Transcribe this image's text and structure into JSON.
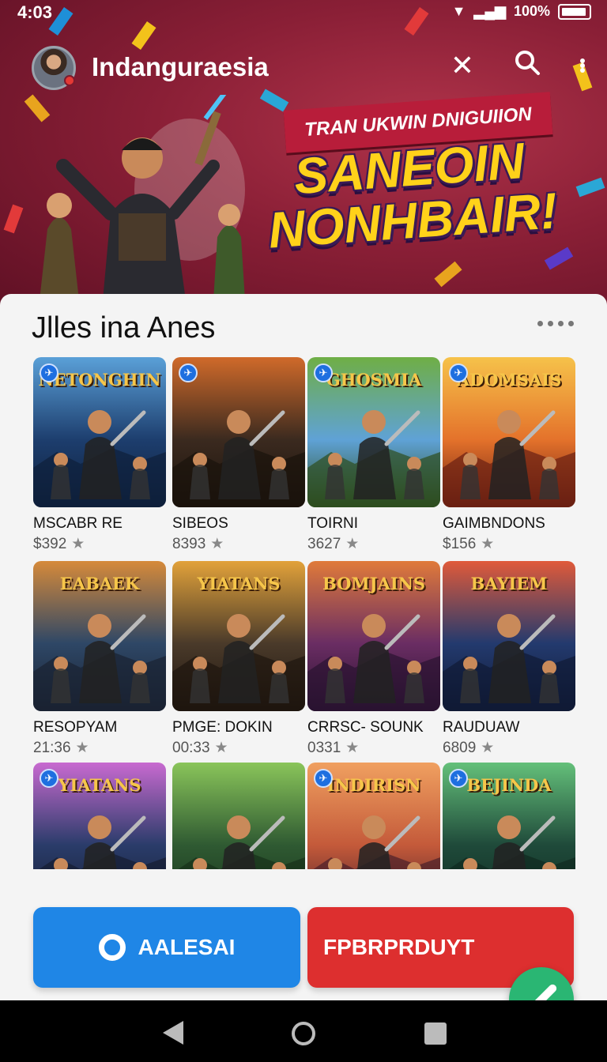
{
  "status": {
    "time": "4:03",
    "battery": "100%"
  },
  "appbar": {
    "title": "Indanguraesia"
  },
  "banner": {
    "ribbon": "TRAN UKWIN DNIGUIION",
    "line1": "SANEOIN",
    "line2": "NONHBAIR!"
  },
  "section": {
    "title": "Jlles ina Anes"
  },
  "games": [
    {
      "thumb_title": "NETONGHIN",
      "name": "MSCABR RE",
      "meta": "$392",
      "badge": true,
      "palette": [
        "#1d3e6e",
        "#5aa0d8",
        "#0e1f3a"
      ]
    },
    {
      "thumb_title": "",
      "name": "SIBEOS",
      "meta": "8393",
      "badge": true,
      "palette": [
        "#3b2a1f",
        "#d06a2a",
        "#1a120c"
      ]
    },
    {
      "thumb_title": "GHOSMIA",
      "name": "TOIRNI",
      "meta": "3627",
      "badge": true,
      "palette": [
        "#5fa2d6",
        "#6fae45",
        "#2d4d1e"
      ]
    },
    {
      "thumb_title": "ADOMSAIS",
      "name": "GAIMBNDONS",
      "meta": "$156",
      "badge": true,
      "palette": [
        "#e4722b",
        "#f6c24a",
        "#6a1f12"
      ]
    },
    {
      "thumb_title": "EABAEK",
      "name": "RESOPYAM",
      "meta": "21:36",
      "badge": false,
      "palette": [
        "#2e4766",
        "#d68a3a",
        "#1a2232"
      ]
    },
    {
      "thumb_title": "YIATANS",
      "name": "PMGE: DOKIN",
      "meta": "00:33",
      "badge": false,
      "palette": [
        "#4a3a2a",
        "#e2a23a",
        "#1e150e"
      ]
    },
    {
      "thumb_title": "BOMJAINS",
      "name": "CRRSC- SOUNK",
      "meta": "0331",
      "badge": false,
      "palette": [
        "#6a2d63",
        "#e07a3a",
        "#2a1230"
      ]
    },
    {
      "thumb_title": "BAYIEM",
      "name": "RAUDUAW",
      "meta": "6809",
      "badge": false,
      "palette": [
        "#233a6e",
        "#e05a3a",
        "#101a35"
      ]
    },
    {
      "thumb_title": "YIATANS",
      "name": "",
      "meta": "",
      "badge": true,
      "palette": [
        "#2a3c6a",
        "#c86ad0",
        "#151c30"
      ]
    },
    {
      "thumb_title": "",
      "name": "",
      "meta": "",
      "badge": false,
      "palette": [
        "#2f5a32",
        "#8ac55a",
        "#17301a"
      ]
    },
    {
      "thumb_title": "INDIRISN",
      "name": "",
      "meta": "",
      "badge": true,
      "palette": [
        "#c45a3a",
        "#f0a060",
        "#4a1f2a"
      ]
    },
    {
      "thumb_title": "BEJINDA",
      "name": "",
      "meta": "",
      "badge": true,
      "palette": [
        "#1f4a3a",
        "#64c07a",
        "#0f2a20"
      ]
    }
  ],
  "buttons": {
    "left": "AALESAI",
    "right": "FPBRPRDUYT"
  }
}
